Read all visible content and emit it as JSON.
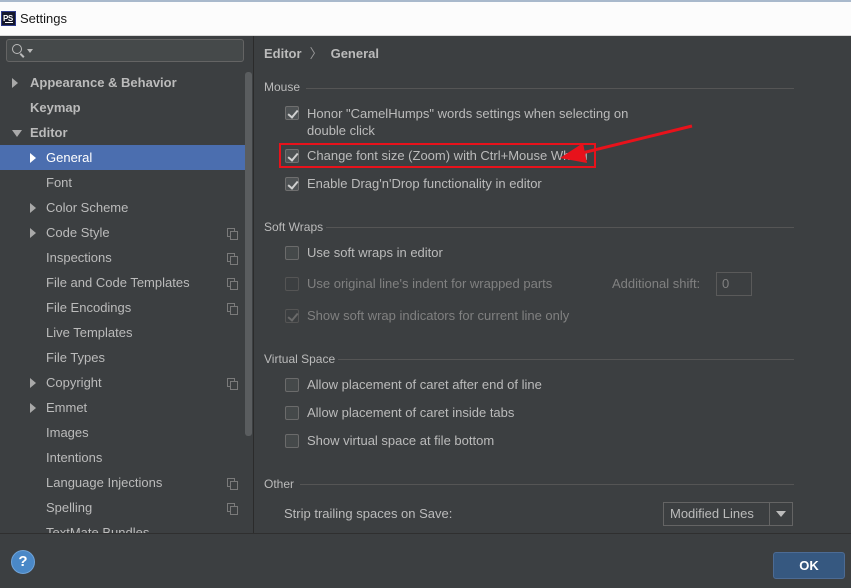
{
  "window": {
    "title": "Settings",
    "app_icon_text": "PS"
  },
  "search": {
    "placeholder": "",
    "icon": "search-icon"
  },
  "tree": [
    {
      "label": "Appearance & Behavior",
      "level": 0,
      "bold": true,
      "arrow": "right"
    },
    {
      "label": "Keymap",
      "level": 0,
      "bold": true,
      "arrow": "none"
    },
    {
      "label": "Editor",
      "level": 0,
      "bold": true,
      "arrow": "down"
    },
    {
      "label": "General",
      "level": 1,
      "arrow": "right",
      "selected": true
    },
    {
      "label": "Font",
      "level": 1,
      "arrow": "none"
    },
    {
      "label": "Color Scheme",
      "level": 1,
      "arrow": "right"
    },
    {
      "label": "Code Style",
      "level": 1,
      "arrow": "right",
      "project_icon": true
    },
    {
      "label": "Inspections",
      "level": 1,
      "arrow": "none",
      "project_icon": true
    },
    {
      "label": "File and Code Templates",
      "level": 1,
      "arrow": "none",
      "project_icon": true
    },
    {
      "label": "File Encodings",
      "level": 1,
      "arrow": "none",
      "project_icon": true
    },
    {
      "label": "Live Templates",
      "level": 1,
      "arrow": "none"
    },
    {
      "label": "File Types",
      "level": 1,
      "arrow": "none"
    },
    {
      "label": "Copyright",
      "level": 1,
      "arrow": "right",
      "project_icon": true
    },
    {
      "label": "Emmet",
      "level": 1,
      "arrow": "right"
    },
    {
      "label": "Images",
      "level": 1,
      "arrow": "none"
    },
    {
      "label": "Intentions",
      "level": 1,
      "arrow": "none"
    },
    {
      "label": "Language Injections",
      "level": 1,
      "arrow": "none",
      "project_icon": true
    },
    {
      "label": "Spelling",
      "level": 1,
      "arrow": "none",
      "project_icon": true
    },
    {
      "label": "TextMate Bundles",
      "level": 1,
      "arrow": "none"
    }
  ],
  "breadcrumb": {
    "parent": "Editor",
    "separator": "〉",
    "current": "General"
  },
  "sections": {
    "mouse": {
      "title": "Mouse",
      "options": [
        {
          "label": "Honor \"CamelHumps\" words settings when selecting on double click",
          "checked": true
        },
        {
          "label": "Change font size (Zoom) with Ctrl+Mouse Wheel",
          "checked": true
        },
        {
          "label": "Enable Drag'n'Drop functionality in editor",
          "checked": true
        }
      ]
    },
    "soft_wraps": {
      "title": "Soft Wraps",
      "options": [
        {
          "label": "Use soft wraps in editor",
          "checked": false,
          "disabled": false
        },
        {
          "label": "Use original line's indent for wrapped parts",
          "checked": false,
          "disabled": true
        },
        {
          "label": "Show soft wrap indicators for current line only",
          "checked": true,
          "disabled": true
        }
      ],
      "additional_shift_label": "Additional shift:",
      "additional_shift_value": "0"
    },
    "virtual_space": {
      "title": "Virtual Space",
      "options": [
        {
          "label": "Allow placement of caret after end of line",
          "checked": false
        },
        {
          "label": "Allow placement of caret inside tabs",
          "checked": false
        },
        {
          "label": "Show virtual space at file bottom",
          "checked": false
        }
      ]
    },
    "other": {
      "title": "Other",
      "strip_label": "Strip trailing spaces on Save:",
      "strip_value": "Modified Lines"
    }
  },
  "annotation": {
    "color": "#e8121b"
  },
  "footer": {
    "help_label": "?",
    "ok_label": "OK"
  },
  "colors": {
    "background": "#3c3f41",
    "selection": "#4b6eaf",
    "ok_button": "#365880",
    "help_button": "#4a88c7"
  }
}
